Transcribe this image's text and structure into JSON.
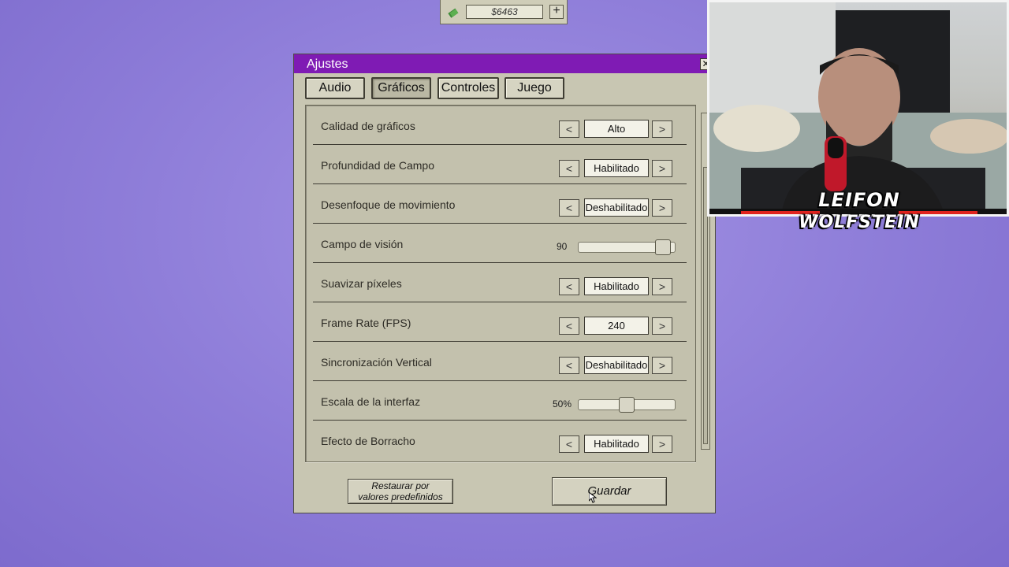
{
  "money": {
    "amount": "$6463",
    "add_label": "+"
  },
  "window": {
    "title": "Ajustes",
    "close_label": "✕"
  },
  "tabs": [
    {
      "label": "Audio",
      "active": false
    },
    {
      "label": "Gráficos",
      "active": true
    },
    {
      "label": "Controles",
      "active": false
    },
    {
      "label": "Juego",
      "active": false
    }
  ],
  "settings": [
    {
      "label": "Calidad de gráficos",
      "type": "selector",
      "value": "Alto"
    },
    {
      "label": "Profundidad de Campo",
      "type": "selector",
      "value": "Habilitado"
    },
    {
      "label": "Desenfoque de movimiento",
      "type": "selector",
      "value": "Deshabilitado"
    },
    {
      "label": "Campo de visión",
      "type": "slider",
      "value": "90",
      "fraction": 0.95
    },
    {
      "label": "Suavizar píxeles",
      "type": "selector",
      "value": "Habilitado"
    },
    {
      "label": "Frame Rate (FPS)",
      "type": "selector",
      "value": "240"
    },
    {
      "label": "Sincronización Vertical",
      "type": "selector",
      "value": "Deshabilitado"
    },
    {
      "label": "Escala de la interfaz",
      "type": "slider",
      "value": "50%",
      "fraction": 0.5
    },
    {
      "label": "Efecto de Borracho",
      "type": "selector",
      "value": "Habilitado"
    }
  ],
  "buttons": {
    "reset_line1": "Restaurar por",
    "reset_line2": "valores predefinidos",
    "save": "Guardar"
  },
  "arrows": {
    "left": "<",
    "right": ">"
  },
  "webcam": {
    "logo_line1": "LEIFON",
    "logo_line2": "WOLFSTEIN"
  },
  "colors": {
    "titlebar": "#7f1bb4",
    "background": "#8d7cd8",
    "window": "#c8c6b2"
  }
}
